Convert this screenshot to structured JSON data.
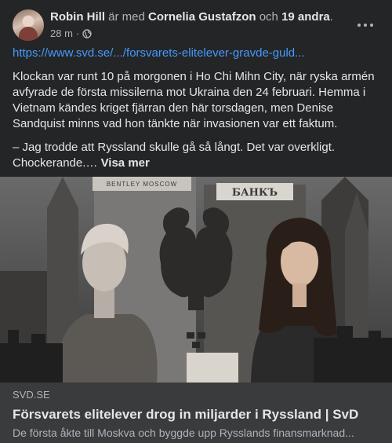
{
  "post": {
    "author": "Robin Hill",
    "with_text": " är med ",
    "tagged": "Cornelia Gustafzon",
    "and_text": " och ",
    "others": "19 andra",
    "period": ".",
    "time": "28 m",
    "separator": "·",
    "privacy_icon": "globe-icon",
    "more_icon": "more-options-icon",
    "link_url": "https://www.svd.se/.../forsvarets-elitelever-gravde-guld...",
    "paragraph1": "Klockan var runt 10 på morgonen i Ho Chi Mihn City, när ryska armén avfyrade de första missilerna mot Ukraina den 24 februari. Hemma i Vietnam kändes kriget fjärran den här torsdagen, men Denise Sandquist minns vad hon tänkte när invasionen var ett faktum.",
    "paragraph2": "– Jag trodde att Ryssland skulle gå så långt. Det var overkligt. Chockerande.… ",
    "see_more": "Visa mer"
  },
  "image": {
    "sign_left": "BENTLEY MOSCOW",
    "sign_right": "БАНКЪ"
  },
  "link_card": {
    "domain": "SVD.SE",
    "title": "Försvarets elitelever drog in miljarder i Ryssland | SvD",
    "description": "De första åkte till Moskva och byggde upp Rysslands finansmarknad..."
  }
}
